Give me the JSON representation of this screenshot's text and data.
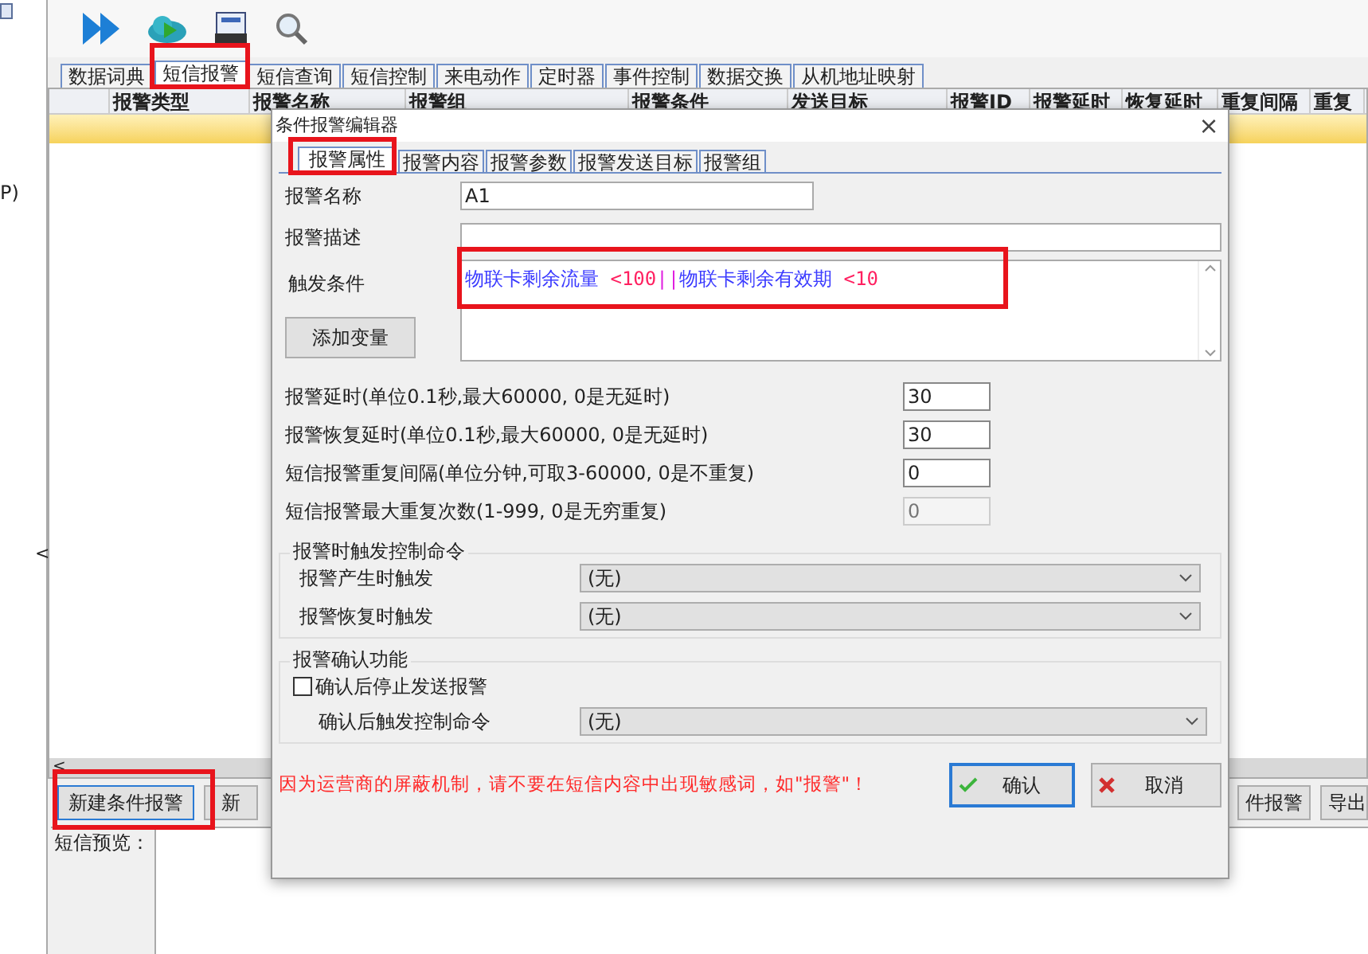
{
  "side_panel": {
    "texts": [
      "P)",
      "<"
    ]
  },
  "main_tabs": [
    {
      "label": "数据词典",
      "selected": false
    },
    {
      "label": "短信报警",
      "selected": true
    },
    {
      "label": "短信查询",
      "selected": false
    },
    {
      "label": "短信控制",
      "selected": false
    },
    {
      "label": "来电动作",
      "selected": false
    },
    {
      "label": "定时器",
      "selected": false
    },
    {
      "label": "事件控制",
      "selected": false
    },
    {
      "label": "数据交换",
      "selected": false
    },
    {
      "label": "从机地址映射",
      "selected": false
    }
  ],
  "table": {
    "columns": [
      "报警类型",
      "报警名称",
      "报警组",
      "报警条件",
      "发送目标",
      "报警ID",
      "报警延时",
      "恢复延时",
      "重复间隔",
      "重复"
    ],
    "rows": [
      {
        "selected": true
      }
    ],
    "scroll_left": "<"
  },
  "bottom_buttons": [
    "新建条件报警",
    "新",
    "件报警",
    "导出"
  ],
  "preview": {
    "label": "短信预览："
  },
  "dialog": {
    "title": "条件报警编辑器",
    "close": "×",
    "tabs": [
      {
        "label": "报警属性",
        "selected": true
      },
      {
        "label": "报警内容",
        "selected": false
      },
      {
        "label": "报警参数",
        "selected": false
      },
      {
        "label": "报警发送目标",
        "selected": false
      },
      {
        "label": "报警组",
        "selected": false
      }
    ],
    "name": {
      "label": "报警名称",
      "value": "A1"
    },
    "description": {
      "label": "报警描述"
    },
    "condition": {
      "label": "触发条件",
      "button": "添加变量",
      "tokens": [
        {
          "text": "物联卡剩余流量",
          "kind": "variable"
        },
        {
          "text": " <100",
          "kind": "operator"
        },
        {
          "text": "||",
          "kind": "logic"
        },
        {
          "text": "物联卡剩余有效期",
          "kind": "variable"
        },
        {
          "text": " <10",
          "kind": "operator"
        }
      ]
    },
    "numbers": [
      {
        "label": "报警延时(单位0.1秒,最大60000, 0是无延时)",
        "value": "30",
        "disabled": false
      },
      {
        "label": "报警恢复延时(单位0.1秒,最大60000, 0是无延时)",
        "value": "30",
        "disabled": false
      },
      {
        "label": "短信报警重复间隔(单位分钟,可取3-60000, 0是不重复)",
        "value": "0",
        "disabled": false
      },
      {
        "label": "短信报警最大重复次数(1-999, 0是无穷重复)",
        "value": "0",
        "disabled": true
      }
    ],
    "control_group": {
      "title": "报警时触发控制命令",
      "rows": [
        {
          "label": "报警产生时触发",
          "value": "(无)"
        },
        {
          "label": "报警恢复时触发",
          "value": "(无)"
        }
      ]
    },
    "confirm_group": {
      "title": "报警确认功能",
      "checkbox": {
        "label": "确认后停止发送报警",
        "checked": false
      },
      "row": {
        "label": "确认后触发控制命令",
        "value": "(无)"
      }
    },
    "warning": "因为运营商的屏蔽机制，请不要在短信内容中出现敏感词，如\"报警\"！",
    "ok": "确认",
    "cancel": "取消"
  }
}
